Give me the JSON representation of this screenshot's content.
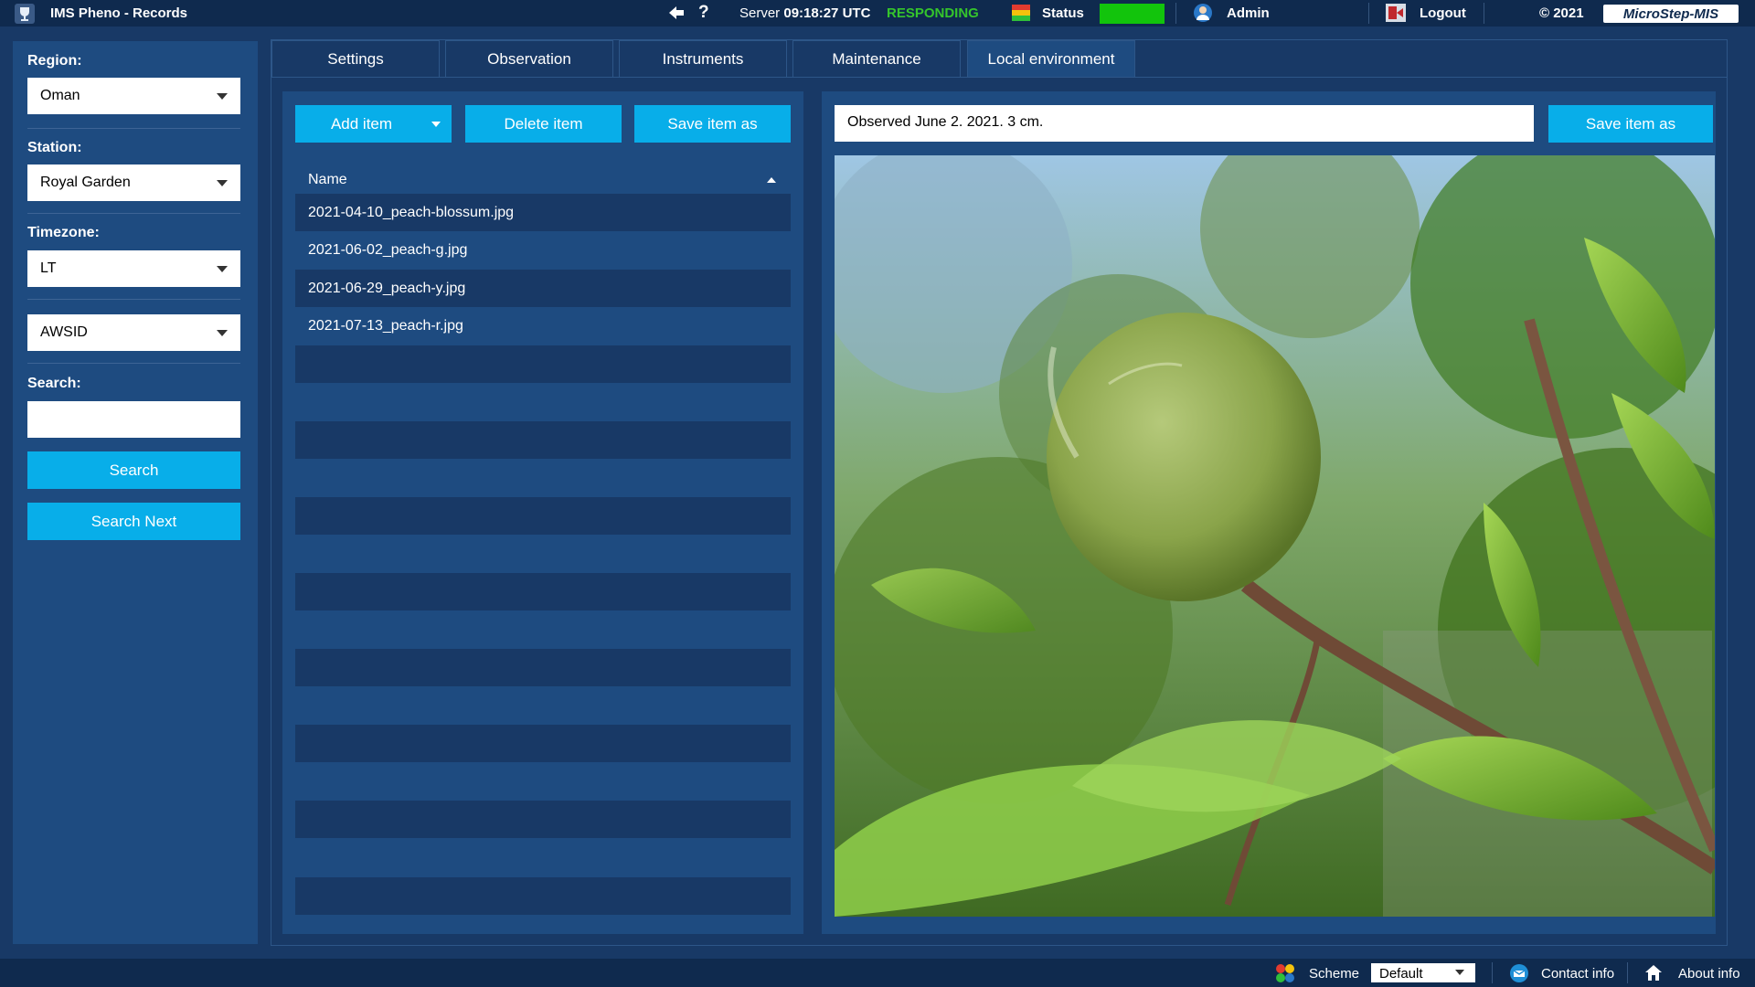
{
  "app": {
    "title": "IMS Pheno - Records"
  },
  "topbar": {
    "server_label": "Server",
    "server_time": "09:18:27 UTC",
    "responding": "RESPONDING",
    "status_label": "Status",
    "status_color": "#12c40c",
    "admin_label": "Admin",
    "logout_label": "Logout",
    "copyright": "© 2021",
    "brand": "MicroStep-MIS"
  },
  "sidebar": {
    "region_label": "Region:",
    "region_value": "Oman",
    "station_label": "Station:",
    "station_value": "Royal Garden",
    "timezone_label": "Timezone:",
    "timezone_value": "LT",
    "id_value": "AWSID",
    "search_label": "Search:",
    "search_value": "",
    "search_button": "Search",
    "search_next_button": "Search Next"
  },
  "tabs": [
    {
      "label": "Settings"
    },
    {
      "label": "Observation"
    },
    {
      "label": "Instruments"
    },
    {
      "label": "Maintenance"
    },
    {
      "label": "Local environment"
    }
  ],
  "active_tab": "Local environment",
  "files_panel": {
    "add_item": "Add item",
    "delete_item": "Delete item",
    "save_item_as": "Save item as",
    "column_name": "Name",
    "rows": [
      "2021-04-10_peach-blossum.jpg",
      "2021-06-02_peach-g.jpg",
      "2021-06-29_peach-y.jpg",
      "2021-07-13_peach-r.jpg"
    ]
  },
  "detail_panel": {
    "note": "Observed June 2. 2021. 3 cm.",
    "save_item_as": "Save item as"
  },
  "footer": {
    "scheme_label": "Scheme",
    "scheme_value": "Default",
    "contact_label": "Contact info",
    "about_label": "About info"
  },
  "colors": {
    "accent": "#08aee9",
    "panel": "#1e4b80",
    "background": "#183966",
    "bar": "#0f2a4e",
    "responding": "#35c52c"
  }
}
